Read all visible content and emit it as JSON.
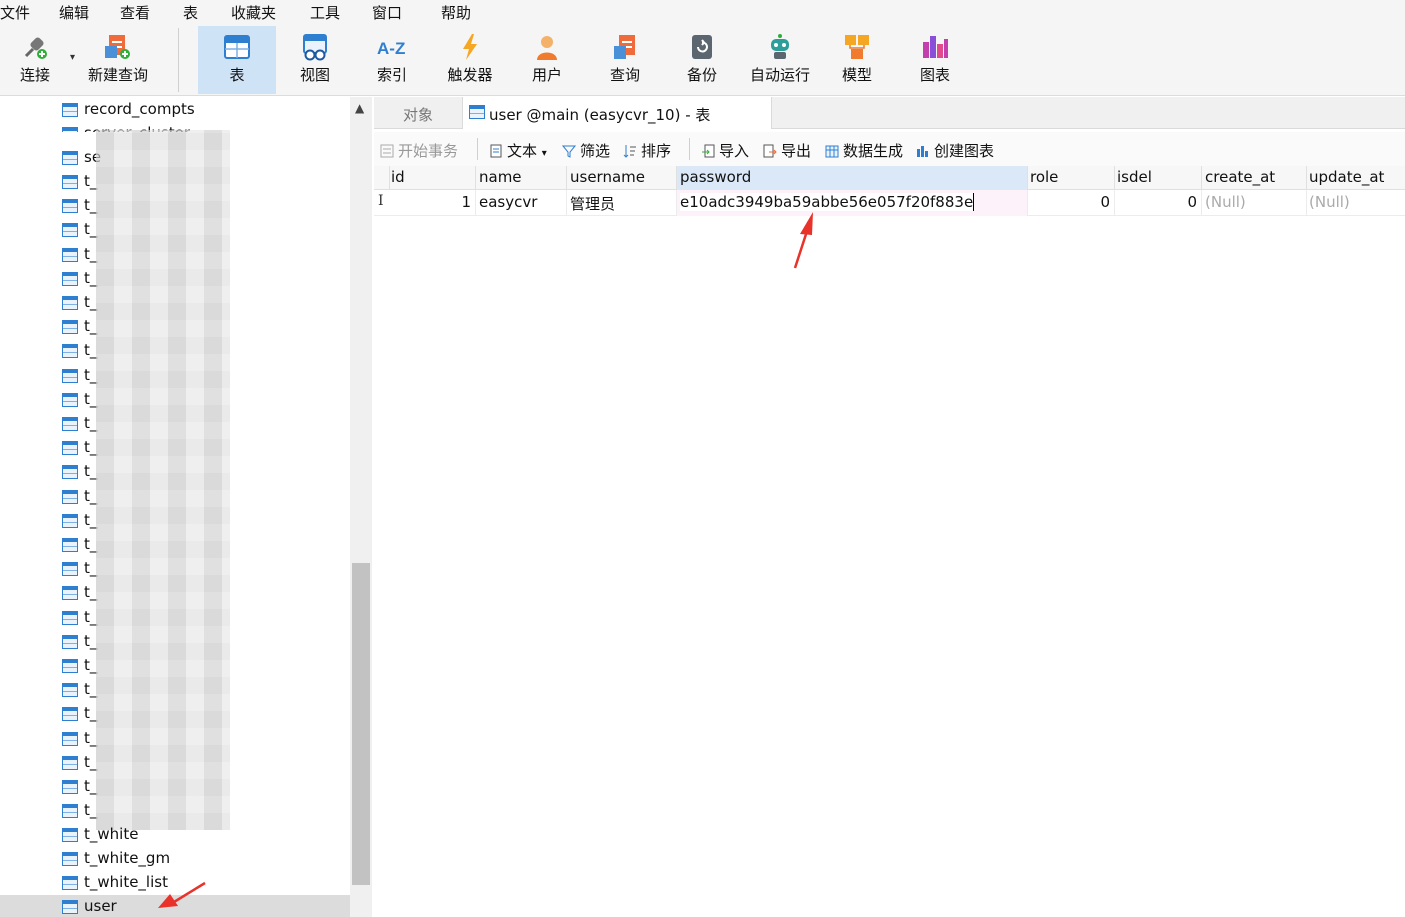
{
  "menu": [
    "文件",
    "编辑",
    "查看",
    "表",
    "收藏夹",
    "工具",
    "窗口",
    "帮助"
  ],
  "toolbar": {
    "connect": "连接",
    "new_query": "新建查询",
    "table": "表",
    "view": "视图",
    "index": "索引",
    "trigger": "触发器",
    "user": "用户",
    "query": "查询",
    "backup": "备份",
    "automation": "自动运行",
    "model": "模型",
    "chart": "图表"
  },
  "sidebar": {
    "top_items": [
      "record_compts",
      "server_cluster",
      "se"
    ],
    "prefix": "t_",
    "bottom_items": [
      "t_white",
      "t_white_gm",
      "t_white_list"
    ],
    "selected": "user"
  },
  "tabs": {
    "objects": "对象",
    "active": "user @main (easycvr_10) - 表"
  },
  "table_tools": {
    "begin_tx": "开始事务",
    "text": "文本",
    "filter": "筛选",
    "sort": "排序",
    "import": "导入",
    "export": "导出",
    "generate": "数据生成",
    "create_chart": "创建图表"
  },
  "grid": {
    "columns": [
      "id",
      "name",
      "username",
      "password",
      "role",
      "isdel",
      "create_at",
      "update_at"
    ],
    "row": {
      "id": "1",
      "name": "easycvr",
      "username": "管理员",
      "password": "e10adc3949ba59abbe56e057f20f883e",
      "role": "0",
      "isdel": "0",
      "create_at": "(Null)",
      "update_at": "(Null)"
    }
  },
  "colors": {
    "accent": "#2f7fd0",
    "active_tool": "#cfe3f7",
    "arrow": "#e8322a"
  }
}
